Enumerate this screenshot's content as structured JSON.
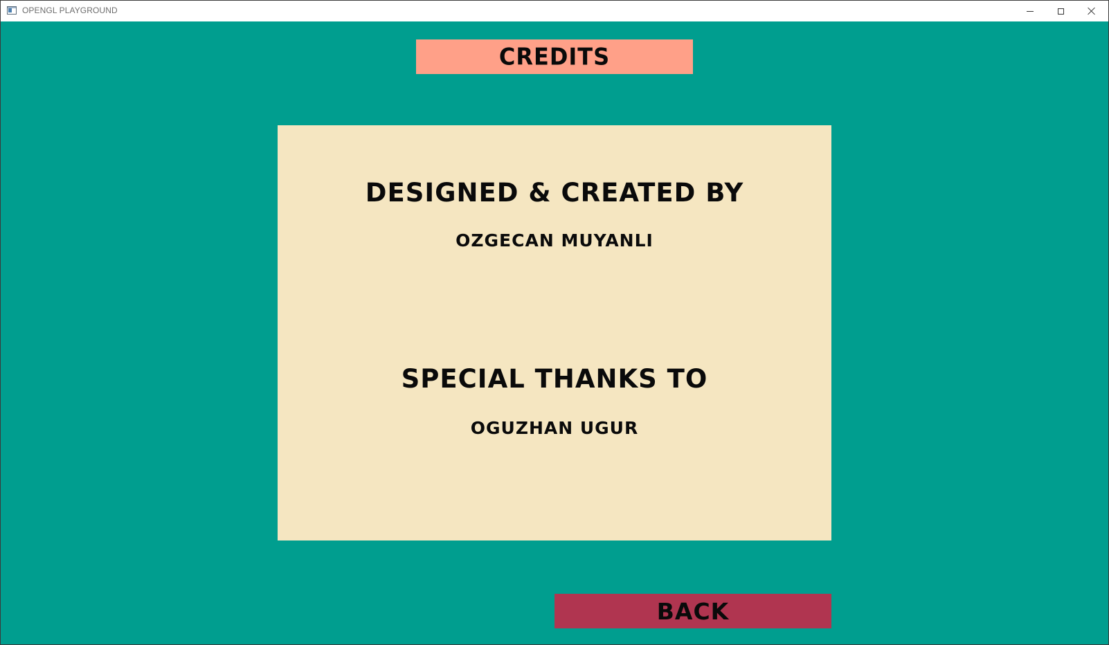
{
  "window": {
    "title": "OPENGL PLAYGROUND",
    "app_icon": "app-window-icon",
    "controls": {
      "minimize_icon": "minimize-icon",
      "maximize_icon": "maximize-icon",
      "close_icon": "close-icon"
    }
  },
  "colors": {
    "background": "#009e8f",
    "banner": "#ffa088",
    "panel": "#f5e6c1",
    "back_button": "#b03550",
    "text": "#0a0a0a"
  },
  "header": {
    "banner_label": "CREDITS"
  },
  "credits": {
    "designed_heading": "DESIGNED & CREATED BY",
    "designer_name": "OZGECAN MUYANLI",
    "thanks_heading": "SPECIAL THANKS TO",
    "thanks_name": "OGUZHAN UGUR"
  },
  "footer": {
    "back_label": "BACK"
  }
}
